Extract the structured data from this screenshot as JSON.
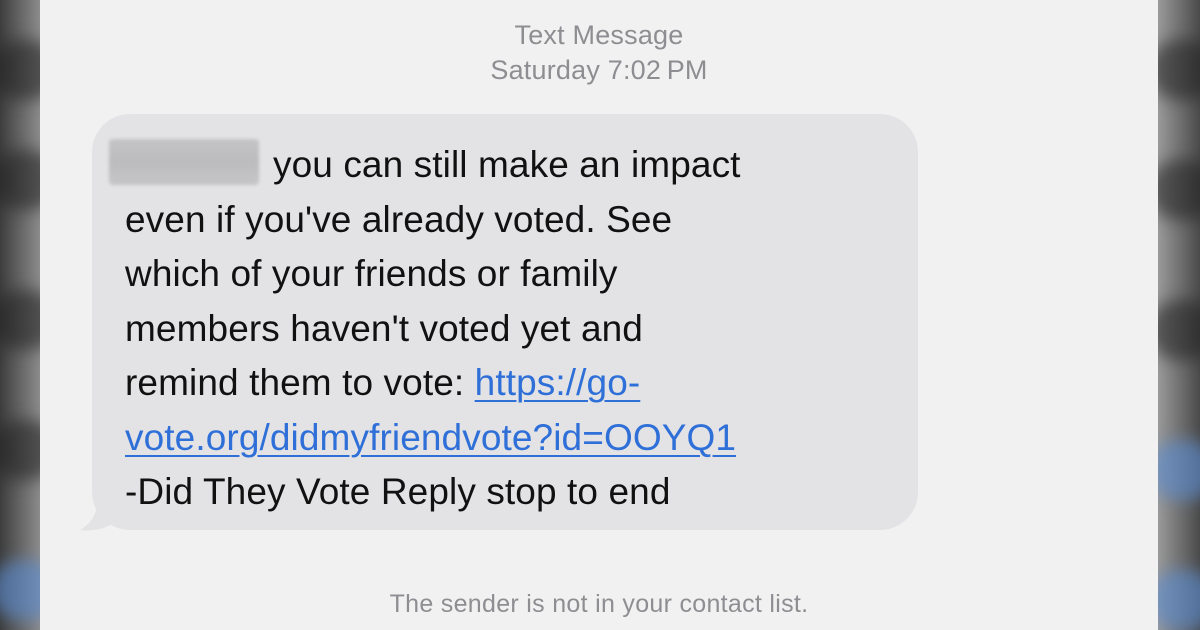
{
  "header": {
    "service_label": "Text Message",
    "timestamp": "Saturday 7:02 PM"
  },
  "message": {
    "sender_name_redacted": true,
    "lines": [
      "you can still make an impact",
      "even if you've already voted. See",
      "which of your friends or family",
      "members haven't voted yet and"
    ],
    "line5_prefix": "remind them to vote: ",
    "link_part1": "https://go-",
    "link_part2": "vote.org/didmyfriendvote?id=OOYQ1",
    "closing": "-Did They Vote Reply stop to end"
  },
  "footer": {
    "notice": "The sender is not in your contact list."
  },
  "colors": {
    "screen_background": "#f1f1f1",
    "bubble_background": "#e3e3e5",
    "link": "#2f6fd8",
    "meta_text": "#8e8e92"
  }
}
